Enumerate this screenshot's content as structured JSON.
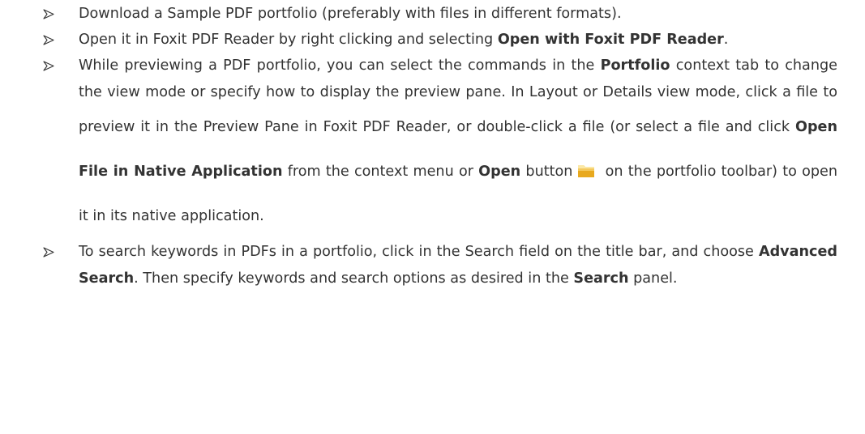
{
  "doc": {
    "items": [
      {
        "segments": [
          {
            "text": "Download a Sample PDF portfolio (preferably with files in different formats)."
          }
        ]
      },
      {
        "segments": [
          {
            "text": "Open it in Foxit PDF Reader by right clicking and selecting "
          },
          {
            "text": "Open with Foxit PDF Reader"
          },
          {
            "text": "."
          }
        ]
      },
      {
        "segments": [
          {
            "text": "While previewing a PDF portfolio, you can select the commands in the "
          },
          {
            "text": "Portfolio"
          },
          {
            "text": " context tab to change the view mode or specify how to display the preview pane. In Layout or Details view mode, click a file to preview it in the Preview Pane in Foxit PDF Reader, or double-click a file (or select a file and click "
          },
          {
            "text": "Open File in Native Application"
          },
          {
            "text": " from the context menu or "
          },
          {
            "text": "Open"
          },
          {
            "text": " button"
          },
          {
            "text": " on the portfolio toolbar) to open it in its native application."
          }
        ]
      },
      {
        "segments": [
          {
            "text": "To search keywords in PDFs in a portfolio, click in the Search field on the title bar, and choose "
          },
          {
            "text": "Advanced Search"
          },
          {
            "text": ". Then specify keywords and search options as desired in the "
          },
          {
            "text": "Search"
          },
          {
            "text": " panel."
          }
        ]
      }
    ]
  },
  "icons": {
    "bullet": "arrow-bullet-icon",
    "open_button": "folder-icon"
  },
  "colors": {
    "text": "#333333",
    "folder_light": "#fbe8a6",
    "folder_mid": "#f4c95d",
    "folder_dark": "#e8a91f"
  }
}
